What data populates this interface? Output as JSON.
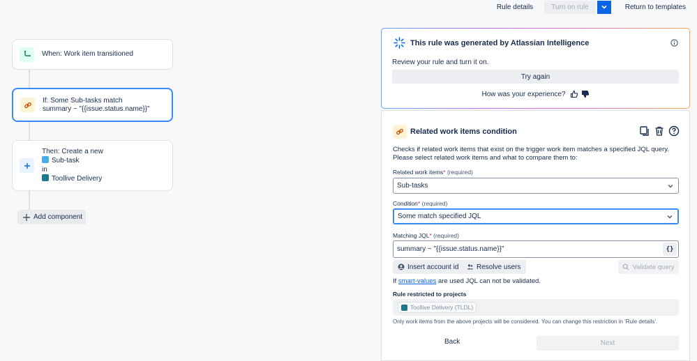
{
  "topbar": {
    "rule_details": "Rule details",
    "turn_on": "Turn on rule",
    "return": "Return to templates"
  },
  "flow": {
    "trigger": {
      "label": "When: Work item transitioned"
    },
    "condition": {
      "line1": "If: Some Sub-tasks match",
      "line2": "summary ~ \"{{issue.status.name}}\""
    },
    "action": {
      "line1": "Then: Create a new",
      "issue_type": "Sub-task",
      "in": "in",
      "project": "Toollive Delivery"
    },
    "add_component": "Add component"
  },
  "ai_panel": {
    "title": "This rule was generated by Atlassian Intelligence",
    "review": "Review your rule and turn it on.",
    "try_again": "Try again",
    "experience": "How was your experience?"
  },
  "condition_panel": {
    "title": "Related work items condition",
    "description": "Checks if related work items that exist on the trigger work item matches a specified JQL query. Please select related work items and what to compare them to:",
    "related_label": "Related work items",
    "required": "(required)",
    "related_value": "Sub-tasks",
    "condition_label": "Condition",
    "condition_value": "Some match specified JQL",
    "jql_label": "Matching JQL",
    "jql_value": "summary ~ \"{{issue.status.name}}\"",
    "brace": "{}",
    "insert_account": "Insert account id",
    "resolve_users": "Resolve users",
    "validate_query": "Validate query",
    "smart_prefix": "If",
    "smart_link": "smart-values",
    "smart_suffix": "are used JQL can not be validated.",
    "restrict_label": "Rule restricted to projects",
    "project_chip": "Toollive Delivery (TLDL)",
    "only_note": "Only work items from the above projects will be considered. You can change this restriction in 'Rule details'.",
    "back": "Back",
    "next": "Next"
  },
  "colors": {
    "accent": "#0c66e4",
    "selected_border": "#388bff"
  }
}
